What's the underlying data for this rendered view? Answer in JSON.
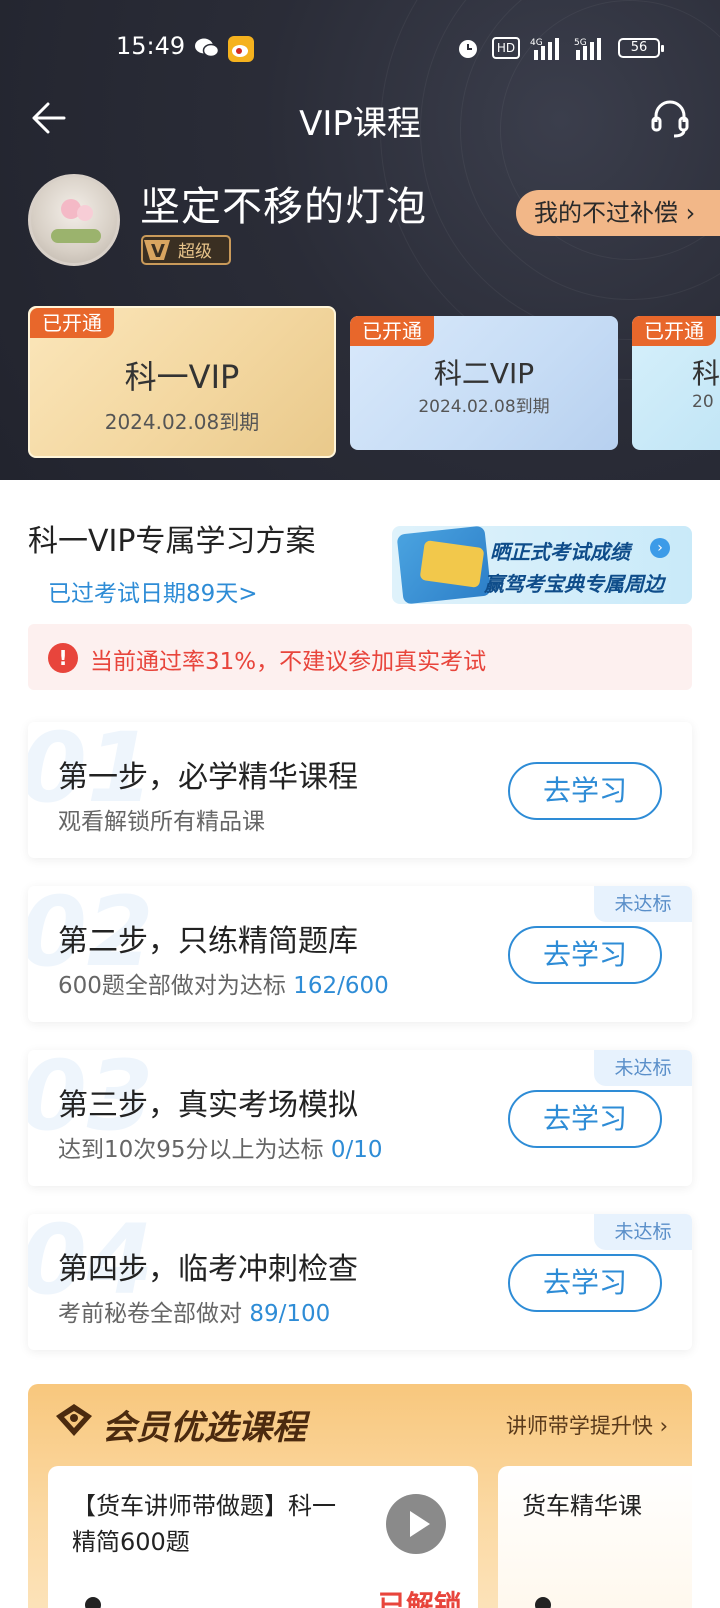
{
  "status_bar": {
    "time": "15:49",
    "battery": "56",
    "hd_label": "HD"
  },
  "header": {
    "title": "VIP课程",
    "username": "坚定不移的灯泡",
    "vip_level": "超级",
    "compensation_button": "我的不过补偿 ›"
  },
  "vip_cards": [
    {
      "tag": "已开通",
      "name": "科一VIP",
      "expiry": "2024.02.08到期"
    },
    {
      "tag": "已开通",
      "name": "科二VIP",
      "expiry": "2024.02.08到期"
    },
    {
      "tag": "已开通",
      "name": "科",
      "expiry": "20"
    }
  ],
  "plan": {
    "title": "科一VIP专属学习方案",
    "exam_date_link": "已过考试日期89天>",
    "promo_line1": "晒正式考试成绩",
    "promo_line2": "赢驾考宝典专属周边",
    "warning": "当前通过率31%，不建议参加真实考试"
  },
  "steps": [
    {
      "num": "01",
      "title": "第一步，必学精华课程",
      "desc": "观看解锁所有精品课",
      "progress": "",
      "button": "去学习",
      "status": ""
    },
    {
      "num": "02",
      "title": "第二步，只练精简题库",
      "desc": "600题全部做对为达标 ",
      "progress": "162/600",
      "button": "去学习",
      "status": "未达标"
    },
    {
      "num": "03",
      "title": "第三步，真实考场模拟",
      "desc": "达到10次95分以上为达标 ",
      "progress": "0/10",
      "button": "去学习",
      "status": "未达标"
    },
    {
      "num": "04",
      "title": "第四步，临考冲刺检查",
      "desc": "考前秘卷全部做对 ",
      "progress": "89/100",
      "button": "去学习",
      "status": "未达标"
    }
  ],
  "courses": {
    "title": "会员优选课程",
    "link": "讲师带学提升快 ›",
    "items": [
      {
        "title": "【货车讲师带做题】科一精简600题",
        "badge": "已解锁"
      },
      {
        "title": "货车精华课"
      }
    ]
  },
  "colors": {
    "accent_blue": "#2e8cd6",
    "warning_red": "#e8453c",
    "tag_orange": "#e8672b"
  }
}
